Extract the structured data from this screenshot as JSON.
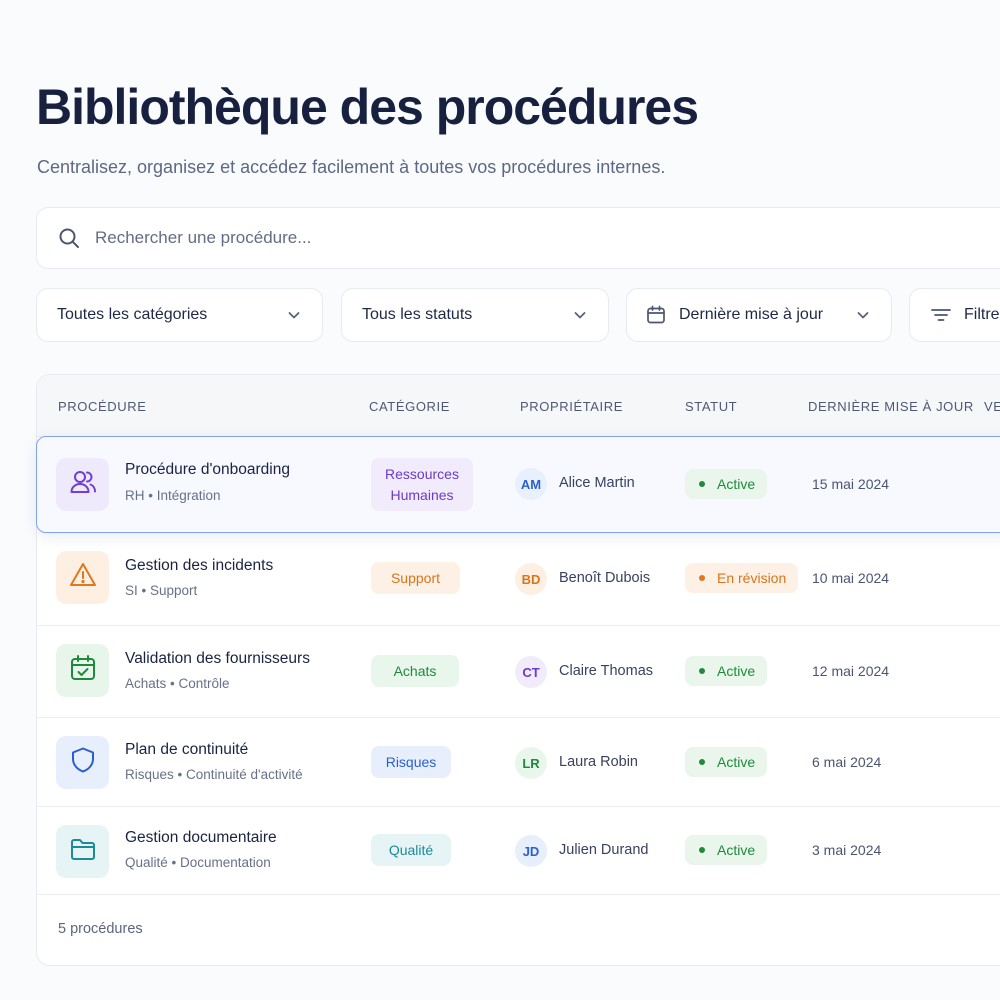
{
  "header": {
    "title": "Bibliothèque des procédures",
    "subtitle": "Centralisez, organisez et accédez facilement à toutes vos procédures internes."
  },
  "search": {
    "placeholder": "Rechercher une procédure..."
  },
  "filters": {
    "category": "Toutes les catégories",
    "status": "Tous les statuts",
    "updated": "Dernière mise à jour",
    "more": "Filtres"
  },
  "table": {
    "columns": [
      "PROCÉDURE",
      "CATÉGORIE",
      "PROPRIÉTAIRE",
      "STATUT",
      "DERNIÈRE MISE À JOUR",
      "VE"
    ],
    "rows": [
      {
        "name": "Procédure d'onboarding",
        "sub": "RH • Intégration",
        "icon": "users-icon",
        "category": "Ressources Humaines",
        "initials": "AM",
        "owner": "Alice Martin",
        "status": "Active",
        "date": "15 mai 2024"
      },
      {
        "name": "Gestion des incidents",
        "sub": "SI • Support",
        "icon": "warning-icon",
        "category": "Support",
        "initials": "BD",
        "owner": "Benoît Dubois",
        "status": "En révision",
        "date": "10 mai 2024"
      },
      {
        "name": "Validation des fournisseurs",
        "sub": "Achats • Contrôle",
        "icon": "calendar-check-icon",
        "category": "Achats",
        "initials": "CT",
        "owner": "Claire Thomas",
        "status": "Active",
        "date": "12 mai 2024"
      },
      {
        "name": "Plan de continuité",
        "sub": "Risques • Continuité d'activité",
        "icon": "shield-icon",
        "category": "Risques",
        "initials": "LR",
        "owner": "Laura Robin",
        "status": "Active",
        "date": "6 mai 2024"
      },
      {
        "name": "Gestion documentaire",
        "sub": "Qualité • Documentation",
        "icon": "folder-icon",
        "category": "Qualité",
        "initials": "JD",
        "owner": "Julien Durand",
        "status": "Active",
        "date": "3 mai 2024"
      }
    ],
    "footer": "5 procédures"
  },
  "colors": {
    "accent": "#7fa3f2",
    "active": "#1f8a3c",
    "revision": "#e0781d",
    "purple": "#6f3fd6",
    "blue": "#2b5fd1",
    "teal": "#1b8a9a"
  }
}
